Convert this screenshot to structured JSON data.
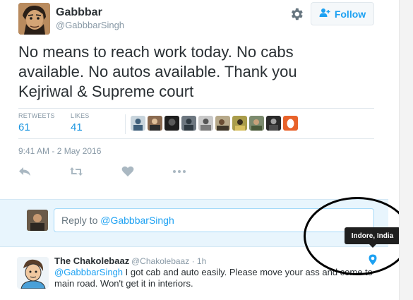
{
  "tweet": {
    "author_name": "Gabbbar",
    "author_handle": "@GabbbarSingh",
    "follow_label": "Follow",
    "text": "No means to reach work today. No cabs available. No autos available. Thank you Kejriwal & Supreme court",
    "stats": {
      "retweets_label": "RETWEETS",
      "retweets_count": "61",
      "likes_label": "LIKES",
      "likes_count": "41"
    },
    "timestamp": "9:41 AM - 2 May 2016",
    "icons": [
      "settings-gear-icon",
      "follow-person-plus-icon",
      "reply-icon",
      "retweet-icon",
      "like-heart-icon",
      "more-icon"
    ]
  },
  "reply": {
    "placeholder_prefix": "Reply to ",
    "placeholder_mention": "@GabbbarSingh"
  },
  "reply_tweet": {
    "author_name": "The Chakolebaaz",
    "author_handle": "@Chakolebaaz",
    "separator": "·",
    "time": "1h",
    "mention": "@GabbbarSingh",
    "text": " I got cab and auto easily. Please move your ass and come to main road. Won't get it in interiors."
  },
  "tooltip": {
    "text": "Indore, India"
  },
  "colors": {
    "link": "#1da1f2",
    "muted": "#8899a6",
    "reply_bg": "#e8f5fd",
    "annotation_circle": "#000000"
  }
}
